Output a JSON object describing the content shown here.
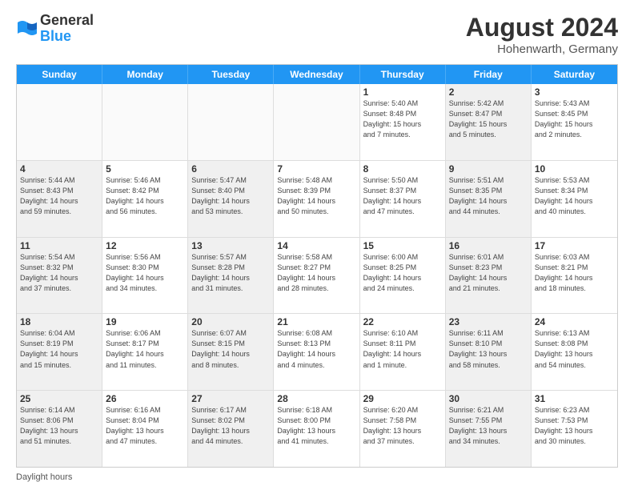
{
  "header": {
    "logo_line1": "General",
    "logo_line2": "Blue",
    "month_year": "August 2024",
    "location": "Hohenwarth, Germany"
  },
  "days_of_week": [
    "Sunday",
    "Monday",
    "Tuesday",
    "Wednesday",
    "Thursday",
    "Friday",
    "Saturday"
  ],
  "weeks": [
    [
      {
        "day": "",
        "info": "",
        "shaded": false,
        "empty": true
      },
      {
        "day": "",
        "info": "",
        "shaded": false,
        "empty": true
      },
      {
        "day": "",
        "info": "",
        "shaded": false,
        "empty": true
      },
      {
        "day": "",
        "info": "",
        "shaded": false,
        "empty": true
      },
      {
        "day": "1",
        "info": "Sunrise: 5:40 AM\nSunset: 8:48 PM\nDaylight: 15 hours\nand 7 minutes.",
        "shaded": false,
        "empty": false
      },
      {
        "day": "2",
        "info": "Sunrise: 5:42 AM\nSunset: 8:47 PM\nDaylight: 15 hours\nand 5 minutes.",
        "shaded": true,
        "empty": false
      },
      {
        "day": "3",
        "info": "Sunrise: 5:43 AM\nSunset: 8:45 PM\nDaylight: 15 hours\nand 2 minutes.",
        "shaded": false,
        "empty": false
      }
    ],
    [
      {
        "day": "4",
        "info": "Sunrise: 5:44 AM\nSunset: 8:43 PM\nDaylight: 14 hours\nand 59 minutes.",
        "shaded": true,
        "empty": false
      },
      {
        "day": "5",
        "info": "Sunrise: 5:46 AM\nSunset: 8:42 PM\nDaylight: 14 hours\nand 56 minutes.",
        "shaded": false,
        "empty": false
      },
      {
        "day": "6",
        "info": "Sunrise: 5:47 AM\nSunset: 8:40 PM\nDaylight: 14 hours\nand 53 minutes.",
        "shaded": true,
        "empty": false
      },
      {
        "day": "7",
        "info": "Sunrise: 5:48 AM\nSunset: 8:39 PM\nDaylight: 14 hours\nand 50 minutes.",
        "shaded": false,
        "empty": false
      },
      {
        "day": "8",
        "info": "Sunrise: 5:50 AM\nSunset: 8:37 PM\nDaylight: 14 hours\nand 47 minutes.",
        "shaded": false,
        "empty": false
      },
      {
        "day": "9",
        "info": "Sunrise: 5:51 AM\nSunset: 8:35 PM\nDaylight: 14 hours\nand 44 minutes.",
        "shaded": true,
        "empty": false
      },
      {
        "day": "10",
        "info": "Sunrise: 5:53 AM\nSunset: 8:34 PM\nDaylight: 14 hours\nand 40 minutes.",
        "shaded": false,
        "empty": false
      }
    ],
    [
      {
        "day": "11",
        "info": "Sunrise: 5:54 AM\nSunset: 8:32 PM\nDaylight: 14 hours\nand 37 minutes.",
        "shaded": true,
        "empty": false
      },
      {
        "day": "12",
        "info": "Sunrise: 5:56 AM\nSunset: 8:30 PM\nDaylight: 14 hours\nand 34 minutes.",
        "shaded": false,
        "empty": false
      },
      {
        "day": "13",
        "info": "Sunrise: 5:57 AM\nSunset: 8:28 PM\nDaylight: 14 hours\nand 31 minutes.",
        "shaded": true,
        "empty": false
      },
      {
        "day": "14",
        "info": "Sunrise: 5:58 AM\nSunset: 8:27 PM\nDaylight: 14 hours\nand 28 minutes.",
        "shaded": false,
        "empty": false
      },
      {
        "day": "15",
        "info": "Sunrise: 6:00 AM\nSunset: 8:25 PM\nDaylight: 14 hours\nand 24 minutes.",
        "shaded": false,
        "empty": false
      },
      {
        "day": "16",
        "info": "Sunrise: 6:01 AM\nSunset: 8:23 PM\nDaylight: 14 hours\nand 21 minutes.",
        "shaded": true,
        "empty": false
      },
      {
        "day": "17",
        "info": "Sunrise: 6:03 AM\nSunset: 8:21 PM\nDaylight: 14 hours\nand 18 minutes.",
        "shaded": false,
        "empty": false
      }
    ],
    [
      {
        "day": "18",
        "info": "Sunrise: 6:04 AM\nSunset: 8:19 PM\nDaylight: 14 hours\nand 15 minutes.",
        "shaded": true,
        "empty": false
      },
      {
        "day": "19",
        "info": "Sunrise: 6:06 AM\nSunset: 8:17 PM\nDaylight: 14 hours\nand 11 minutes.",
        "shaded": false,
        "empty": false
      },
      {
        "day": "20",
        "info": "Sunrise: 6:07 AM\nSunset: 8:15 PM\nDaylight: 14 hours\nand 8 minutes.",
        "shaded": true,
        "empty": false
      },
      {
        "day": "21",
        "info": "Sunrise: 6:08 AM\nSunset: 8:13 PM\nDaylight: 14 hours\nand 4 minutes.",
        "shaded": false,
        "empty": false
      },
      {
        "day": "22",
        "info": "Sunrise: 6:10 AM\nSunset: 8:11 PM\nDaylight: 14 hours\nand 1 minute.",
        "shaded": false,
        "empty": false
      },
      {
        "day": "23",
        "info": "Sunrise: 6:11 AM\nSunset: 8:10 PM\nDaylight: 13 hours\nand 58 minutes.",
        "shaded": true,
        "empty": false
      },
      {
        "day": "24",
        "info": "Sunrise: 6:13 AM\nSunset: 8:08 PM\nDaylight: 13 hours\nand 54 minutes.",
        "shaded": false,
        "empty": false
      }
    ],
    [
      {
        "day": "25",
        "info": "Sunrise: 6:14 AM\nSunset: 8:06 PM\nDaylight: 13 hours\nand 51 minutes.",
        "shaded": true,
        "empty": false
      },
      {
        "day": "26",
        "info": "Sunrise: 6:16 AM\nSunset: 8:04 PM\nDaylight: 13 hours\nand 47 minutes.",
        "shaded": false,
        "empty": false
      },
      {
        "day": "27",
        "info": "Sunrise: 6:17 AM\nSunset: 8:02 PM\nDaylight: 13 hours\nand 44 minutes.",
        "shaded": true,
        "empty": false
      },
      {
        "day": "28",
        "info": "Sunrise: 6:18 AM\nSunset: 8:00 PM\nDaylight: 13 hours\nand 41 minutes.",
        "shaded": false,
        "empty": false
      },
      {
        "day": "29",
        "info": "Sunrise: 6:20 AM\nSunset: 7:58 PM\nDaylight: 13 hours\nand 37 minutes.",
        "shaded": false,
        "empty": false
      },
      {
        "day": "30",
        "info": "Sunrise: 6:21 AM\nSunset: 7:55 PM\nDaylight: 13 hours\nand 34 minutes.",
        "shaded": true,
        "empty": false
      },
      {
        "day": "31",
        "info": "Sunrise: 6:23 AM\nSunset: 7:53 PM\nDaylight: 13 hours\nand 30 minutes.",
        "shaded": false,
        "empty": false
      }
    ]
  ],
  "footer": {
    "daylight_label": "Daylight hours"
  }
}
